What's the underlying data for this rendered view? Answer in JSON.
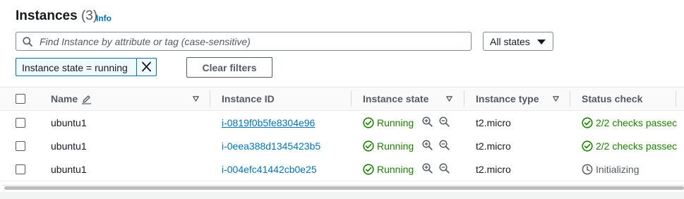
{
  "header": {
    "title": "Instances",
    "count": "(3)",
    "info_label": "Info"
  },
  "search": {
    "placeholder": "Find Instance by attribute or tag (case-sensitive)",
    "value": ""
  },
  "state_filter": {
    "selected": "All states"
  },
  "filter_token": {
    "label": "Instance state = running"
  },
  "clear_filters_label": "Clear filters",
  "table": {
    "columns": [
      "Name",
      "Instance ID",
      "Instance state",
      "Instance type",
      "Status check"
    ],
    "rows": [
      {
        "name": "ubuntu1",
        "instance_id": "i-0819f0b5fe8304e96",
        "state": "Running",
        "type": "t2.micro",
        "status": "2/2 checks passec"
      },
      {
        "name": "ubuntu1",
        "instance_id": "i-0eea388d1345423b5",
        "state": "Running",
        "type": "t2.micro",
        "status": "2/2 checks passec"
      },
      {
        "name": "ubuntu1",
        "instance_id": "i-004efc41442cb0e25",
        "state": "Running",
        "type": "t2.micro",
        "status": "Initializing"
      }
    ]
  },
  "colors": {
    "link": "#0073bb",
    "success": "#1d8102",
    "muted": "#545b64"
  },
  "icons": [
    "search-icon",
    "caret-down-icon",
    "close-icon",
    "edit-pencil-icon",
    "sort-caret-icon",
    "check-circle-icon",
    "zoom-in-icon",
    "zoom-out-icon",
    "clock-icon"
  ]
}
